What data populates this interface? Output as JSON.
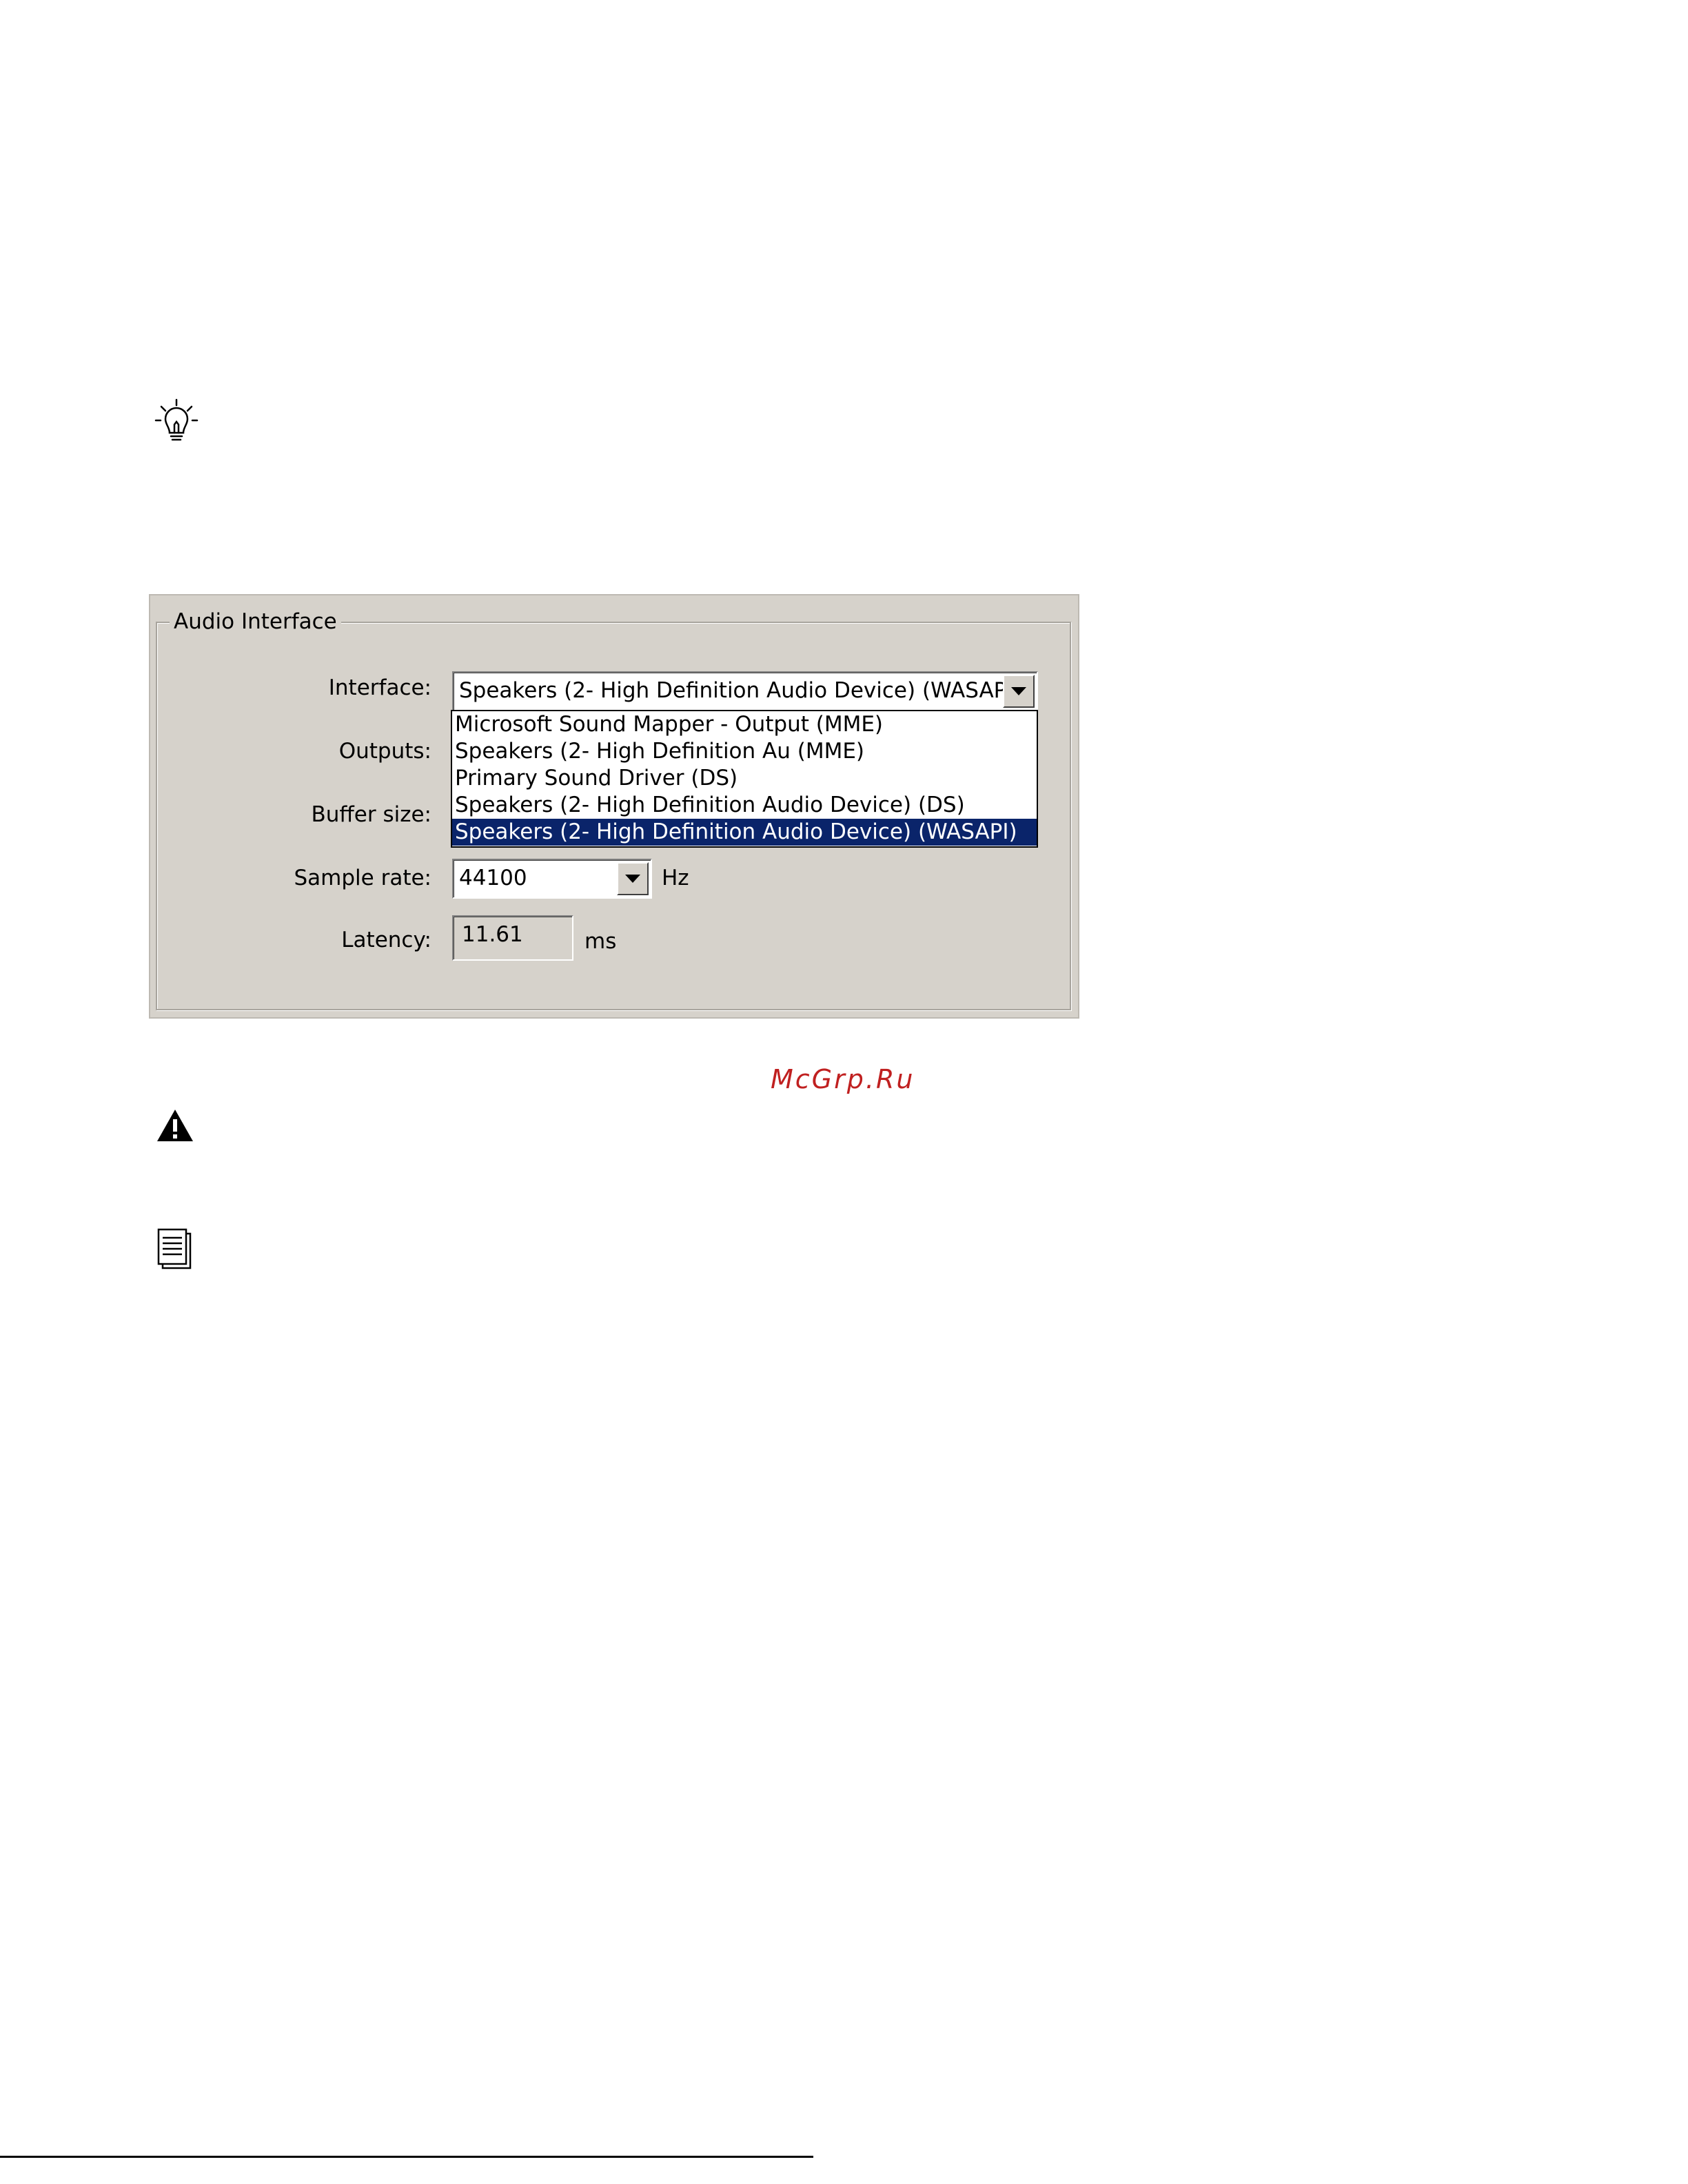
{
  "audio_interface": {
    "group_title": "Audio Interface",
    "interface": {
      "label": "Interface:",
      "value": "Speakers (2- High Definition Audio Device) (WASAPI)",
      "options": [
        "Microsoft Sound Mapper - Output (MME)",
        "Speakers (2- High Definition Au (MME)",
        "Primary Sound Driver (DS)",
        "Speakers (2- High Definition Audio Device) (DS)",
        "Speakers (2- High Definition Audio Device) (WASAPI)"
      ],
      "selected_option": "Speakers (2- High Definition Audio Device) (WASAPI)"
    },
    "outputs": {
      "label": "Outputs:"
    },
    "buffer_size": {
      "label": "Buffer size:"
    },
    "sample_rate": {
      "label": "Sample rate:",
      "value": "44100",
      "unit": "Hz"
    },
    "latency": {
      "label": "Latency:",
      "value": "11.61",
      "unit": "ms"
    }
  },
  "watermark": "McGrp.Ru",
  "icons": {
    "tip": "lightbulb-icon",
    "warning": "warning-icon",
    "note": "document-icon"
  },
  "colors": {
    "dialog_bg": "#d6d2cb",
    "selection_bg": "#0a246a",
    "selection_text": "#ffffff",
    "watermark": "#c02020"
  }
}
